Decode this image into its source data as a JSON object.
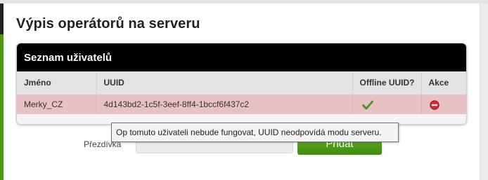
{
  "page": {
    "title": "Výpis operátorů na serveru"
  },
  "users_box": {
    "header": "Seznam uživatelů",
    "columns": [
      "Jméno",
      "UUID",
      "Offline UUID?",
      "Akce"
    ],
    "rows": [
      {
        "name": "Merky_CZ",
        "uuid": "4d143bd2-1c5f-3eef-8ff4-1bccf6f437c2",
        "offline_icon": "check-icon",
        "action_icon": "remove-icon"
      }
    ]
  },
  "tooltip": {
    "text": "Op tomuto uživateli nebude fungovat, UUID neodpovídá modu serveru."
  },
  "form": {
    "nickname_label": "Přezdívka",
    "nickname_value": "",
    "add_button": "Přidat"
  },
  "colors": {
    "accent_green": "#4e9a12",
    "warning_row": "#e8c2c2",
    "remove_red": "#d8262c"
  }
}
